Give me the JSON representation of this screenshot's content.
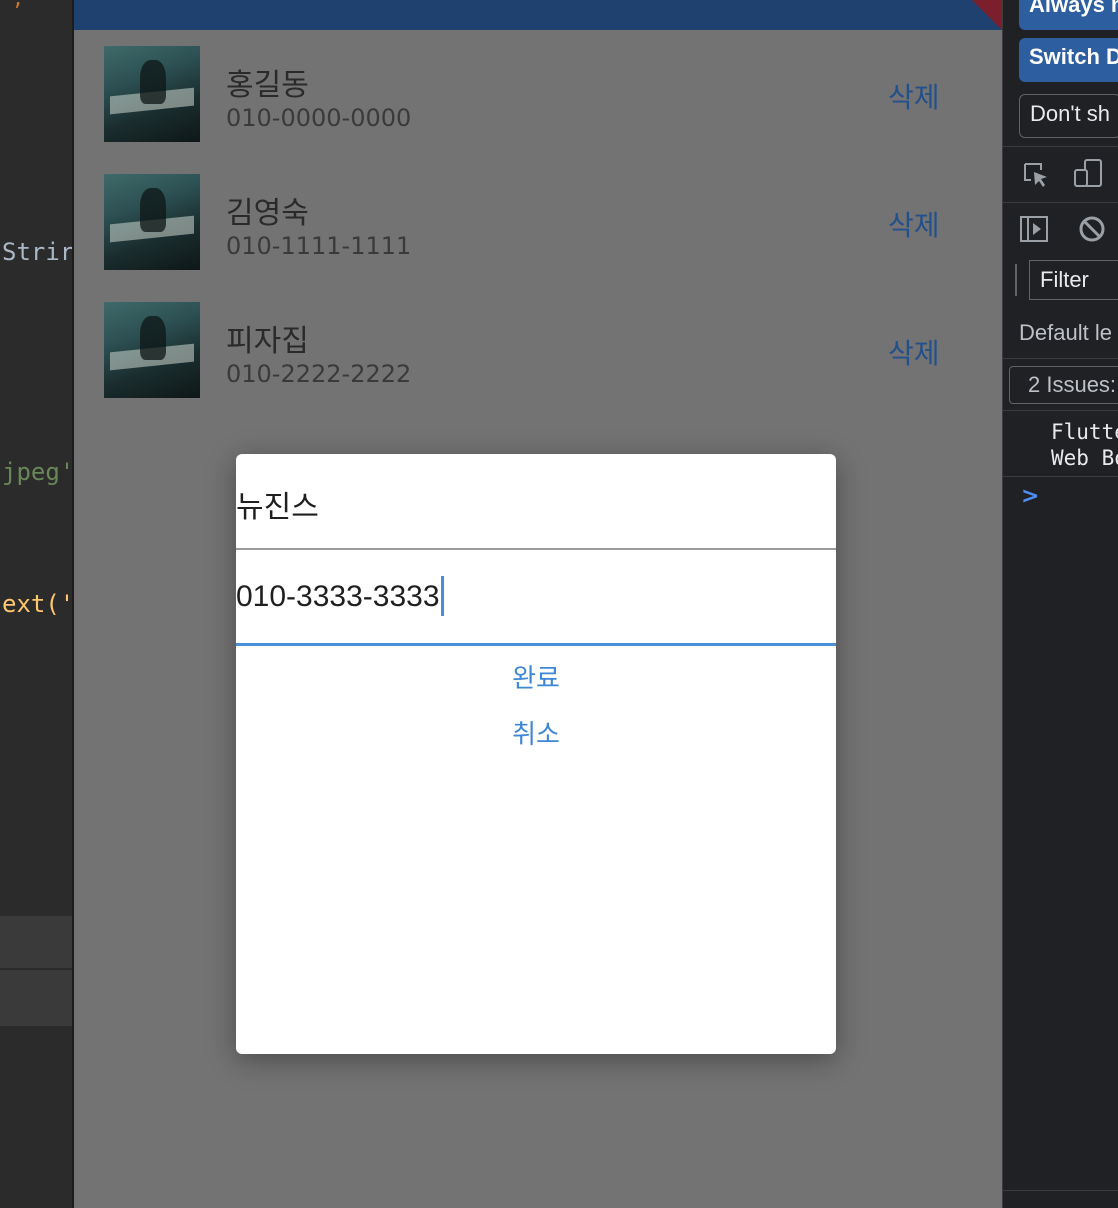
{
  "ide": {
    "line_top": ",",
    "line1": "Strir",
    "line2": "jpeg'",
    "line3": "ext('"
  },
  "contacts": [
    {
      "name": "홍길동",
      "phone": "010-0000-0000",
      "delete_label": "삭제"
    },
    {
      "name": "김영숙",
      "phone": "010-1111-1111",
      "delete_label": "삭제"
    },
    {
      "name": "피자집",
      "phone": "010-2222-2222",
      "delete_label": "삭제"
    }
  ],
  "dialog": {
    "name_value": "뉴진스",
    "phone_value": "010-3333-3333",
    "done_label": "완료",
    "cancel_label": "취소"
  },
  "devtools": {
    "always_btn": "Always m",
    "switch_btn": "Switch D",
    "dont_show_btn": "Don't sh",
    "filter_placeholder": "Filter",
    "default_levels": "Default le",
    "issues": "2 Issues:",
    "console_line1": "Flutte",
    "console_line2": "Web Bo",
    "prompt": ">"
  },
  "colors": {
    "appbar": "#1f4170",
    "delete_text": "#23508b",
    "focus_underline": "#4a90d9",
    "dialog_button": "#3d87d6",
    "devtools_button": "#2c5ea0"
  }
}
